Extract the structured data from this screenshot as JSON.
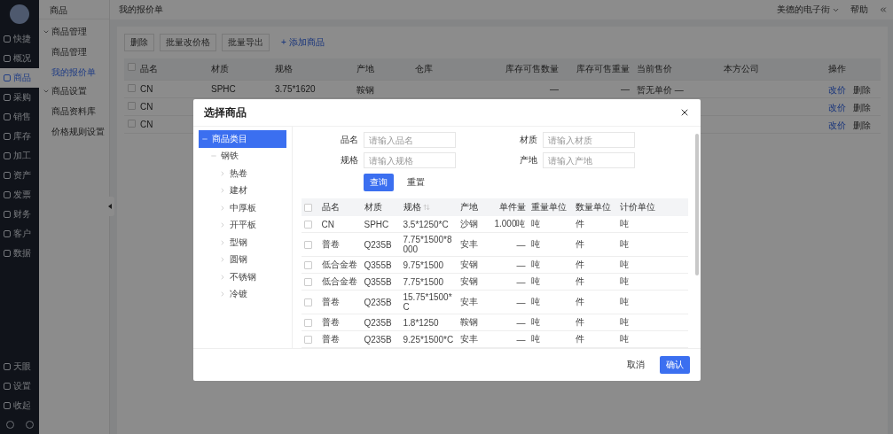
{
  "main_nav": {
    "items": [
      {
        "label": "快捷",
        "selected": false
      },
      {
        "label": "概况",
        "selected": false
      },
      {
        "label": "商品",
        "selected": true
      },
      {
        "label": "采购",
        "selected": false
      },
      {
        "label": "销售",
        "selected": false
      },
      {
        "label": "库存",
        "selected": false
      },
      {
        "label": "加工",
        "selected": false
      },
      {
        "label": "资产",
        "selected": false
      },
      {
        "label": "发票",
        "selected": false
      },
      {
        "label": "财务",
        "selected": false
      },
      {
        "label": "客户",
        "selected": false
      },
      {
        "label": "数据",
        "selected": false
      }
    ],
    "bottom_items": [
      {
        "label": "天眼"
      },
      {
        "label": "设置"
      },
      {
        "label": "收起"
      }
    ]
  },
  "sub_nav": {
    "title": "商品",
    "groups": [
      {
        "label": "商品管理",
        "expanded": true,
        "children": [
          {
            "label": "商品管理",
            "selected": false
          },
          {
            "label": "我的报价单",
            "selected": true
          }
        ]
      },
      {
        "label": "商品设置",
        "expanded": true,
        "children": [
          {
            "label": "商品资料库",
            "selected": false
          },
          {
            "label": "价格规则设置",
            "selected": false
          }
        ]
      }
    ]
  },
  "header": {
    "title": "我的报价单",
    "user": "美德的电子街",
    "help": "帮助"
  },
  "toolbar": {
    "buttons": [
      "删除",
      "批量改价格",
      "批量导出"
    ],
    "add_button": "+ 添加商品"
  },
  "table": {
    "columns": [
      "品名",
      "材质",
      "规格",
      "产地",
      "仓库",
      "库存可售数量",
      "库存可售重量",
      "当前售价",
      "本方公司",
      "操作"
    ],
    "header_checked": false,
    "rows": [
      {
        "checked": false,
        "cells": [
          "CN",
          "SPHC",
          "3.75*1620",
          "鞍钢",
          "",
          "—",
          "—",
          "暂无单价 —",
          ""
        ],
        "actions": [
          "改价",
          "删除"
        ]
      },
      {
        "checked": false,
        "cells": [
          "CN"
        ],
        "actions": [
          "改价",
          "删除"
        ]
      },
      {
        "checked": false,
        "cells": [
          "CN"
        ],
        "actions": [
          "改价",
          "删除"
        ]
      }
    ]
  },
  "dialog": {
    "title": "选择商品",
    "tree": [
      {
        "label": "商品类目",
        "selected": true,
        "expanded": true,
        "children": [
          {
            "label": "钢铁",
            "selected": false,
            "expanded": true,
            "children": [
              {
                "label": "热卷",
                "selected": false,
                "expanded": false
              },
              {
                "label": "建材",
                "selected": false,
                "expanded": false
              },
              {
                "label": "中厚板",
                "selected": false,
                "expanded": false
              },
              {
                "label": "开平板",
                "selected": false,
                "expanded": false
              },
              {
                "label": "型钢",
                "selected": false,
                "expanded": false
              },
              {
                "label": "圆钢",
                "selected": false,
                "expanded": false
              },
              {
                "label": "不锈钢",
                "selected": false,
                "expanded": false
              },
              {
                "label": "冷镀",
                "selected": false,
                "expanded": false
              }
            ]
          }
        ]
      }
    ],
    "filters": [
      {
        "label": "品名",
        "placeholder": "请输入品名"
      },
      {
        "label": "材质",
        "placeholder": "请输入材质"
      },
      {
        "label": "规格",
        "placeholder": "请输入规格"
      },
      {
        "label": "产地",
        "placeholder": "请输入产地"
      }
    ],
    "search_button": "查询",
    "reset_button": "重置",
    "header_checked": false,
    "columns": [
      {
        "label": "品名",
        "sortable": false
      },
      {
        "label": "材质",
        "sortable": false
      },
      {
        "label": "规格",
        "sortable": true
      },
      {
        "label": "产地",
        "sortable": false
      },
      {
        "label": "单件量",
        "sortable": false
      },
      {
        "label": "重量单位",
        "sortable": false
      },
      {
        "label": "数量单位",
        "sortable": false
      },
      {
        "label": "计价单位",
        "sortable": false
      }
    ],
    "rows": [
      {
        "checked": false,
        "cells": [
          "CN",
          "SPHC",
          "3.5*1250*C",
          "沙钢",
          "1.000吨",
          "吨",
          "件",
          "吨"
        ]
      },
      {
        "checked": false,
        "cells": [
          "普卷",
          "Q235B",
          "7.75*1500*8000",
          "安丰",
          "—",
          "吨",
          "件",
          "吨"
        ]
      },
      {
        "checked": false,
        "cells": [
          "低合金卷",
          "Q355B",
          "9.75*1500",
          "安钢",
          "—",
          "吨",
          "件",
          "吨"
        ]
      },
      {
        "checked": false,
        "cells": [
          "低合金卷",
          "Q355B",
          "7.75*1500",
          "安钢",
          "—",
          "吨",
          "件",
          "吨"
        ]
      },
      {
        "checked": false,
        "cells": [
          "普卷",
          "Q235B",
          "15.75*1500*C",
          "安丰",
          "—",
          "吨",
          "件",
          "吨"
        ]
      },
      {
        "checked": false,
        "cells": [
          "普卷",
          "Q235B",
          "1.8*1250",
          "鞍钢",
          "—",
          "吨",
          "件",
          "吨"
        ]
      },
      {
        "checked": false,
        "cells": [
          "普卷",
          "Q235B",
          "9.25*1500*C",
          "安丰",
          "—",
          "吨",
          "件",
          "吨"
        ]
      }
    ],
    "cancel_button": "取消",
    "confirm_button": "确认"
  }
}
